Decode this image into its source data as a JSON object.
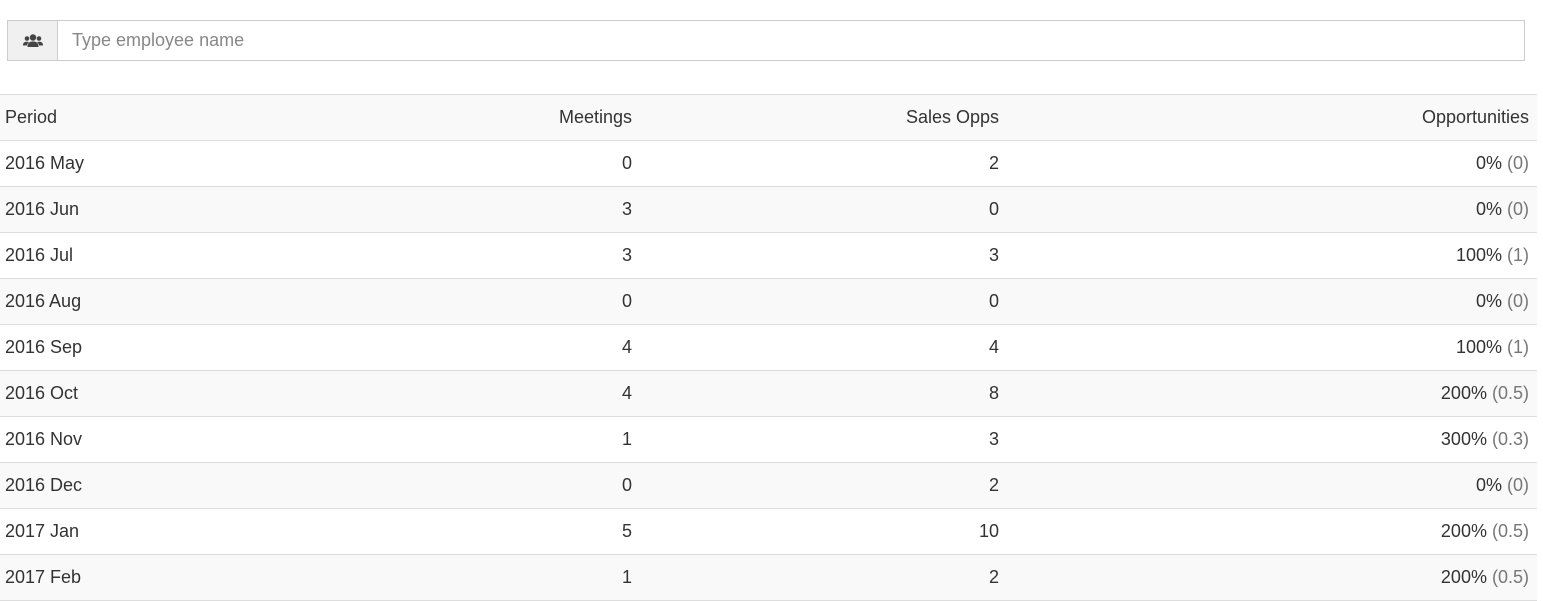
{
  "search": {
    "placeholder": "Type employee name",
    "value": "",
    "icon": "users-icon"
  },
  "table": {
    "headers": {
      "period": "Period",
      "meetings": "Meetings",
      "sales_opps": "Sales Opps",
      "opportunities": "Opportunities"
    },
    "rows": [
      {
        "period": "2016 May",
        "meetings": "0",
        "sales_opps": "2",
        "pct": "0%",
        "ratio": "(0)"
      },
      {
        "period": "2016 Jun",
        "meetings": "3",
        "sales_opps": "0",
        "pct": "0%",
        "ratio": "(0)"
      },
      {
        "period": "2016 Jul",
        "meetings": "3",
        "sales_opps": "3",
        "pct": "100%",
        "ratio": "(1)"
      },
      {
        "period": "2016 Aug",
        "meetings": "0",
        "sales_opps": "0",
        "pct": "0%",
        "ratio": "(0)"
      },
      {
        "period": "2016 Sep",
        "meetings": "4",
        "sales_opps": "4",
        "pct": "100%",
        "ratio": "(1)"
      },
      {
        "period": "2016 Oct",
        "meetings": "4",
        "sales_opps": "8",
        "pct": "200%",
        "ratio": "(0.5)"
      },
      {
        "period": "2016 Nov",
        "meetings": "1",
        "sales_opps": "3",
        "pct": "300%",
        "ratio": "(0.3)"
      },
      {
        "period": "2016 Dec",
        "meetings": "0",
        "sales_opps": "2",
        "pct": "0%",
        "ratio": "(0)"
      },
      {
        "period": "2017 Jan",
        "meetings": "5",
        "sales_opps": "10",
        "pct": "200%",
        "ratio": "(0.5)"
      },
      {
        "period": "2017 Feb",
        "meetings": "1",
        "sales_opps": "2",
        "pct": "200%",
        "ratio": "(0.5)"
      }
    ]
  },
  "colors": {
    "border": "#dddddd",
    "stripe": "#f9f9f9",
    "addon_bg": "#f0f0f0",
    "ratio_text": "#777777"
  }
}
